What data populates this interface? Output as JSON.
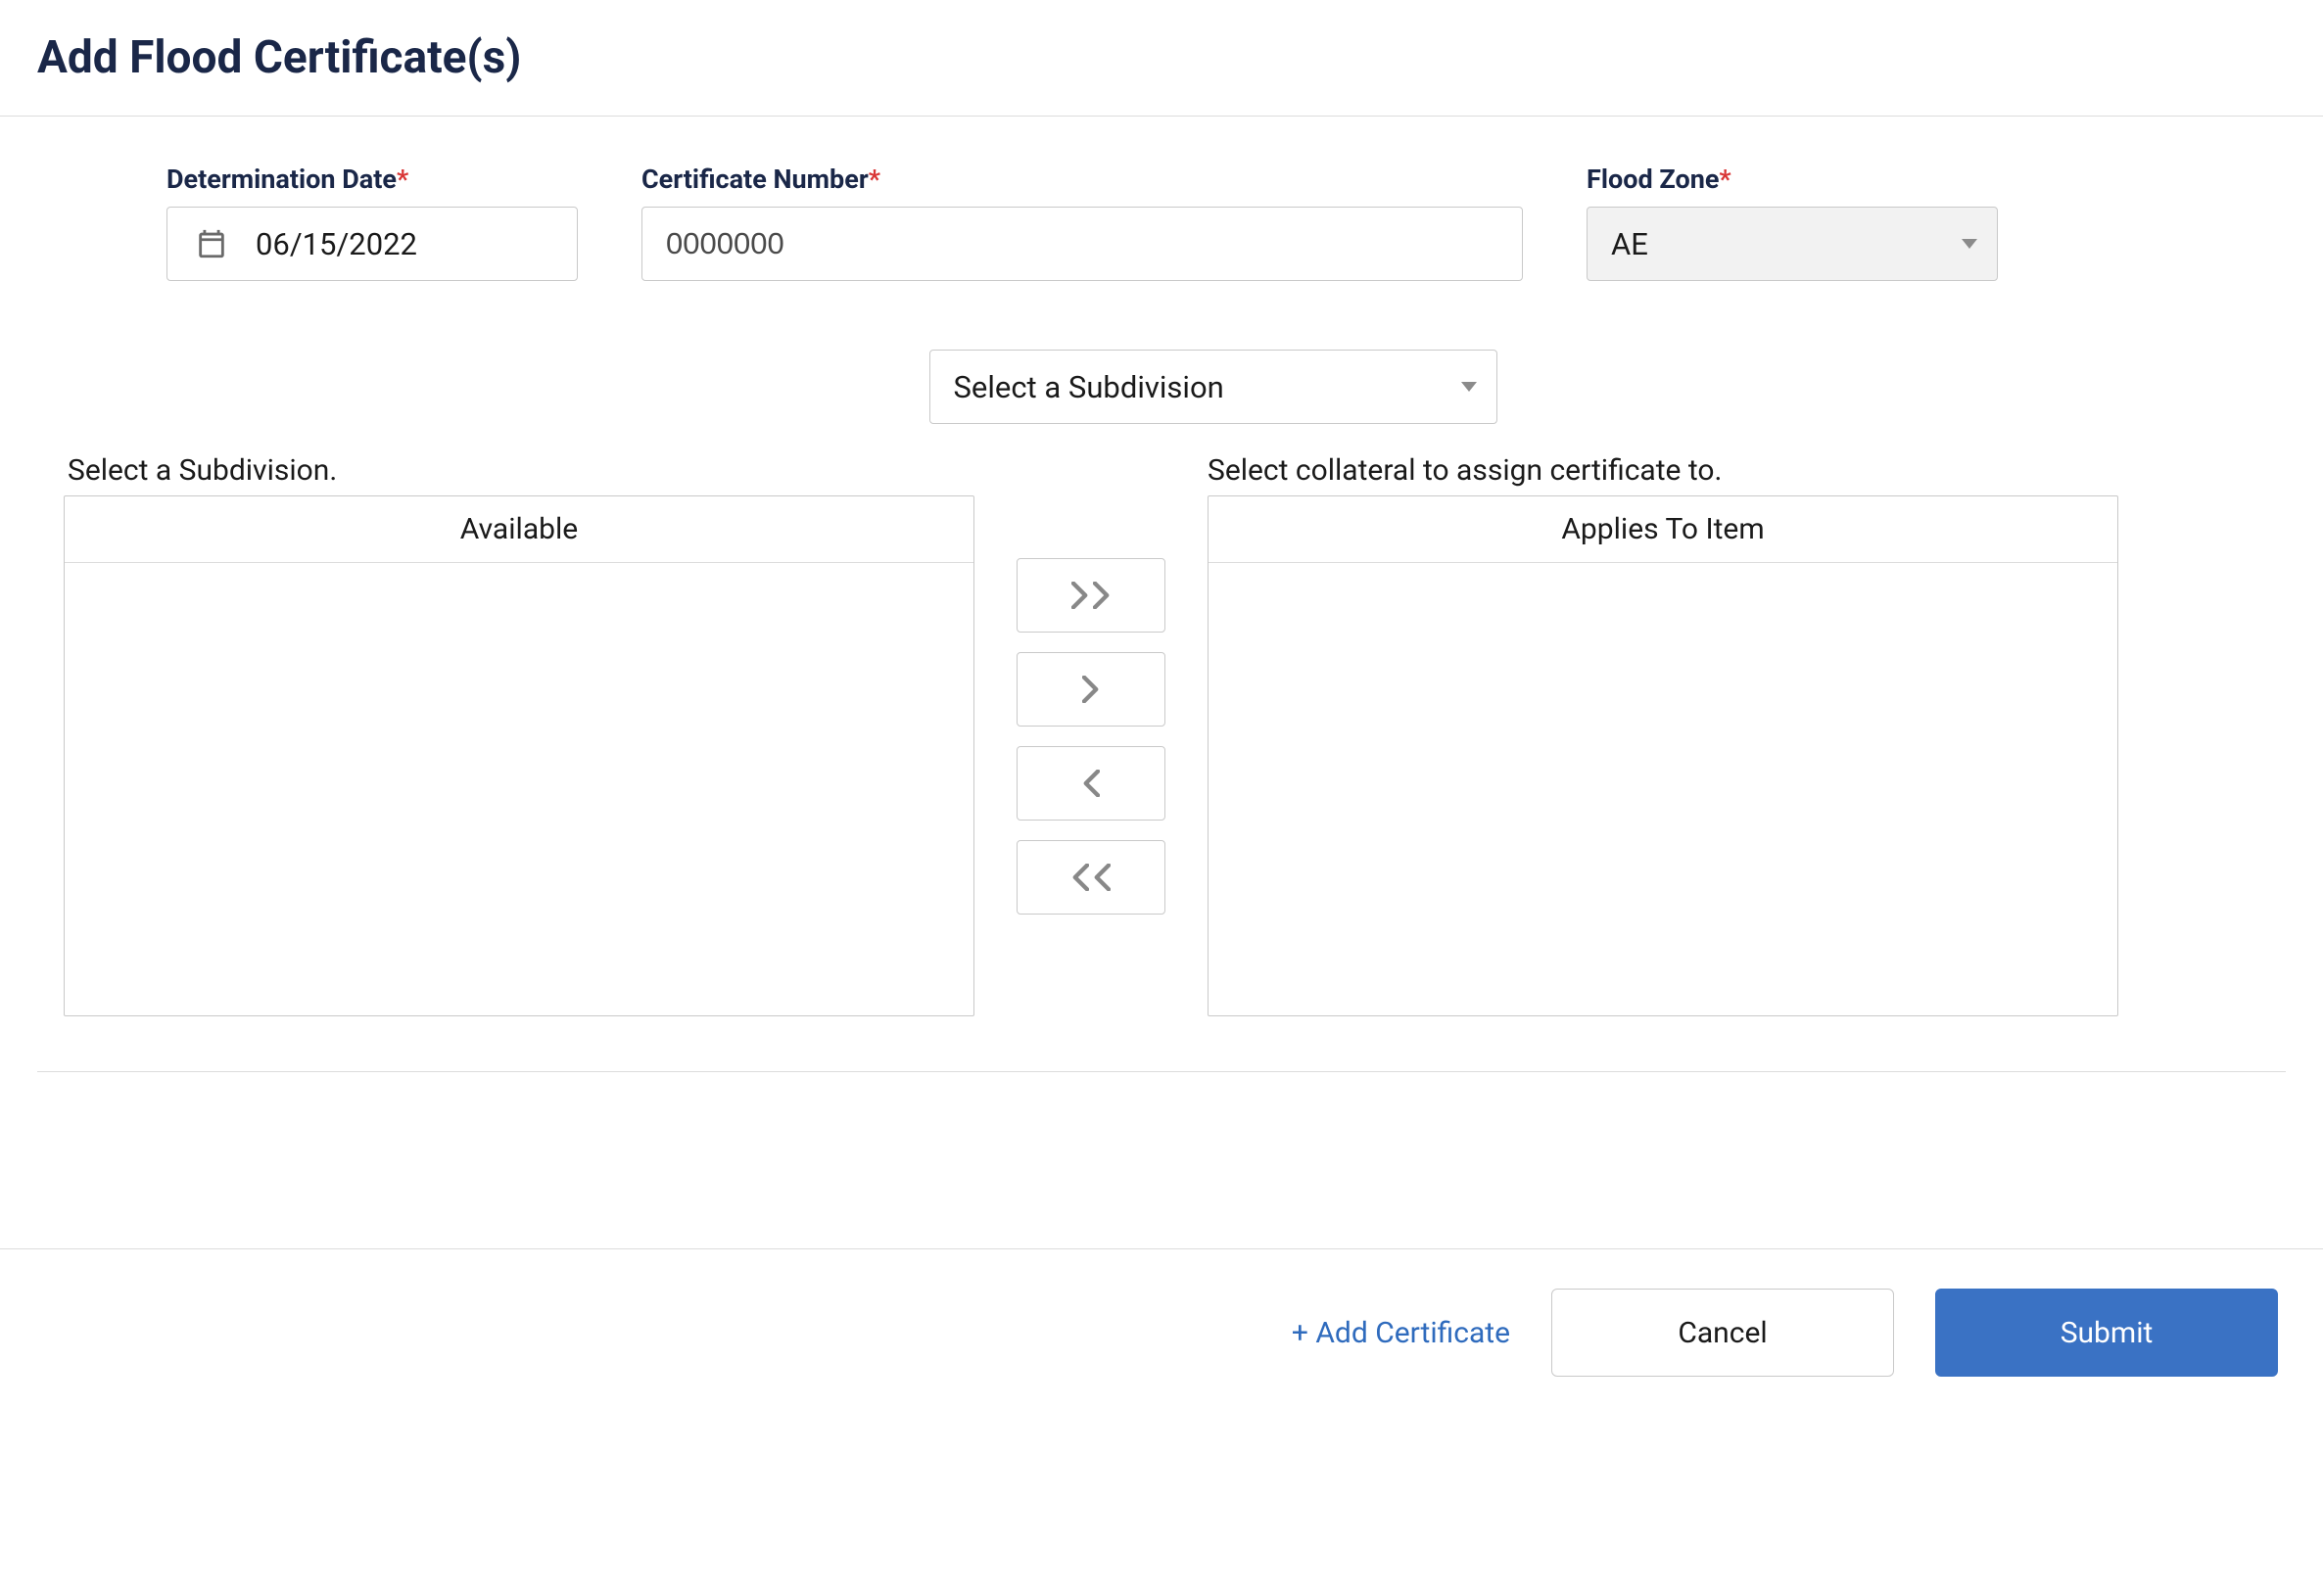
{
  "page": {
    "title": "Add Flood Certificate(s)"
  },
  "fields": {
    "determination_date": {
      "label": "Determination Date",
      "required": "*",
      "value": "06/15/2022"
    },
    "certificate_number": {
      "label": "Certificate Number",
      "required": "*",
      "value": "0000000"
    },
    "flood_zone": {
      "label": "Flood Zone",
      "required": "*",
      "value": "AE"
    },
    "subdivision_select": {
      "placeholder": "Select a Subdivision"
    }
  },
  "transfer": {
    "left_label": "Select a Subdivision.",
    "right_label": "Select collateral to assign certificate to.",
    "available_header": "Available",
    "applies_header": "Applies To Item"
  },
  "footer": {
    "add_link": "+ Add Certificate",
    "cancel": "Cancel",
    "submit": "Submit"
  }
}
